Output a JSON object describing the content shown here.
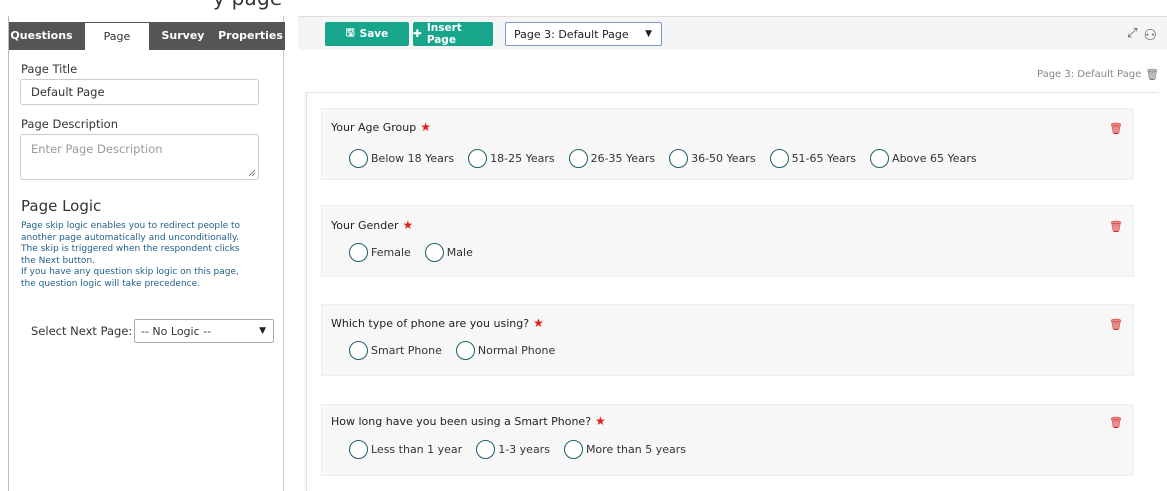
{
  "top_caption": "y                                                        page",
  "left_panel": {
    "tabs": [
      {
        "label": "Questions"
      },
      {
        "label": "Page"
      },
      {
        "label": "Survey"
      },
      {
        "label": "Properties"
      }
    ],
    "page_title_label": "Page Title",
    "page_title_value": "Default Page",
    "page_description_label": "Page Description",
    "page_description_placeholder": "Enter Page Description",
    "logic_title": "Page Logic",
    "logic_text": [
      "Page skip logic enables you to redirect people to",
      "another page automatically and unconditionally.",
      "The skip is triggered when the respondent clicks",
      "the Next button.",
      "If you have any question skip logic on this page,",
      "the question logic will take precedence."
    ],
    "select_next_label": "Select Next Page:",
    "select_next_value": "-- No Logic --"
  },
  "toolbar": {
    "save_label": "Save",
    "insert_page_label": "Insert Page",
    "page_select_value": "Page 3:  Default Page"
  },
  "page_label_right": "Page 3:  Default Page",
  "questions": [
    {
      "title": "Your Age Group",
      "options": [
        "Below 18 Years",
        "18-25 Years",
        "26-35 Years",
        "36-50 Years",
        "51-65 Years",
        "Above 65 Years"
      ]
    },
    {
      "title": "Your Gender",
      "options": [
        "Female",
        "Male"
      ]
    },
    {
      "title": "Which type of phone are you using?",
      "options": [
        "Smart Phone",
        "Normal Phone"
      ]
    },
    {
      "title": "How long have you been using a Smart Phone?",
      "options": [
        "Less than 1 year",
        "1-3 years",
        "More than 5 years"
      ]
    }
  ],
  "colors": {
    "accent_green": "#17a58c",
    "required_red": "#e02020",
    "radio_border": "#1e5f6a",
    "logic_text_blue": "#1f5f8b"
  }
}
